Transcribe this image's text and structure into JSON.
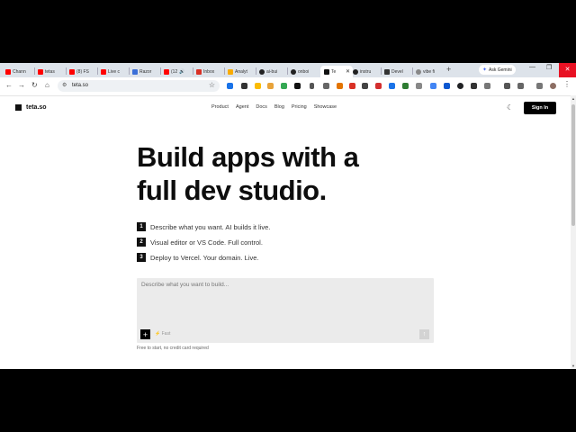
{
  "browser": {
    "tabs": [
      {
        "label": "Chann",
        "color": "#ff0000"
      },
      {
        "label": "tetas",
        "color": "#ff0000"
      },
      {
        "label": "(8) FS",
        "color": "#ff0000"
      },
      {
        "label": "Live c",
        "color": "#ff0000"
      },
      {
        "label": "Razor",
        "color": "#3b6fd8"
      },
      {
        "label": "(12",
        "color": "#ff0000"
      },
      {
        "label": "Inbox",
        "color": "#d93025"
      },
      {
        "label": "Analyt",
        "color": "#f9ab00"
      },
      {
        "label": "ai-bui",
        "color": "#222222"
      },
      {
        "label": "onboi",
        "color": "#222222"
      },
      {
        "label": "Te",
        "color": "#111111"
      },
      {
        "label": "instru",
        "color": "#222222"
      },
      {
        "label": "Devel",
        "color": "#333333"
      },
      {
        "label": "vibe fi",
        "color": "#888888"
      }
    ],
    "active_tab_index": 10,
    "new_tab": "+",
    "gemini_label": "Ask Gemini",
    "url": "teta.so"
  },
  "site": {
    "logo": "teta.so",
    "nav": [
      "Product",
      "Agent",
      "Docs",
      "Blog",
      "Pricing",
      "Showcase"
    ],
    "signin": "Sign In",
    "headline_line1": "Build apps with a",
    "headline_line2": "full dev studio.",
    "features": [
      {
        "num": "1",
        "text": "Describe what you want. AI builds it live."
      },
      {
        "num": "2",
        "text": "Visual editor or VS Code. Full control."
      },
      {
        "num": "3",
        "text": "Deploy to Vercel. Your domain. Live."
      }
    ],
    "prompt_placeholder": "Describe what you want to build...",
    "fast_label": "Fast",
    "footnote": "Free to start, no credit card required"
  }
}
